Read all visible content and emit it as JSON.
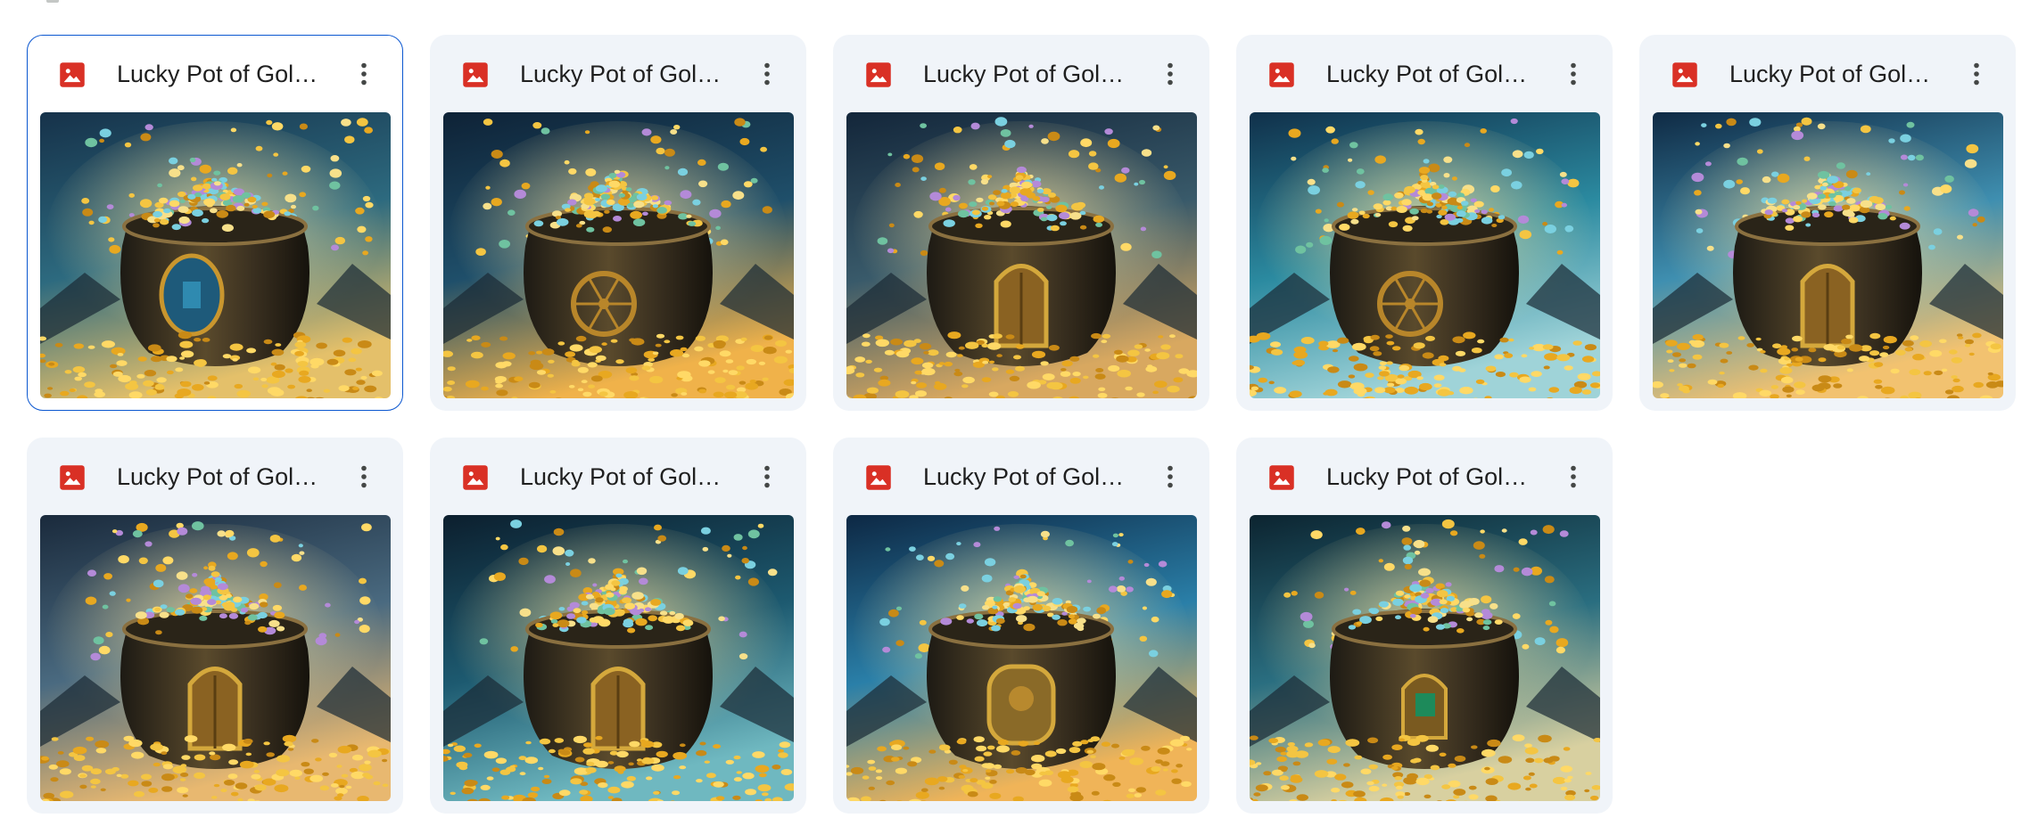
{
  "files": [
    {
      "name": "Lucky Pot of Gold ...",
      "type_icon": "image-file-icon",
      "selected": true,
      "sky": [
        "#16324a",
        "#2d6a7f",
        "#e4c06a"
      ],
      "door": "round-window"
    },
    {
      "name": "Lucky Pot of Gold ...",
      "type_icon": "image-file-icon",
      "selected": false,
      "sky": [
        "#0e2236",
        "#1f4f6a",
        "#f0b24a"
      ],
      "door": "wheel"
    },
    {
      "name": "Lucky Pot of Gold ...",
      "type_icon": "image-file-icon",
      "selected": false,
      "sky": [
        "#13263a",
        "#395a6a",
        "#d8a860"
      ],
      "door": "door"
    },
    {
      "name": "Lucky Pot of Gold ...",
      "type_icon": "image-file-icon",
      "selected": false,
      "sky": [
        "#10304a",
        "#2b8aa0",
        "#9fd3d8"
      ],
      "door": "wheel"
    },
    {
      "name": "Lucky Pot of Gold ...",
      "type_icon": "image-file-icon",
      "selected": false,
      "sky": [
        "#0f2a44",
        "#3f8fb0",
        "#f2c270"
      ],
      "door": "door"
    },
    {
      "name": "Lucky Pot of Gold ...",
      "type_icon": "image-file-icon",
      "selected": false,
      "sky": [
        "#1a2a3c",
        "#4a6a80",
        "#e8b870"
      ],
      "door": "door"
    },
    {
      "name": "Lucky Pot of Gold ...",
      "type_icon": "image-file-icon",
      "selected": false,
      "sky": [
        "#0c1f2e",
        "#1d5a70",
        "#6fb8c0"
      ],
      "door": "door"
    },
    {
      "name": "Lucky Pot of Gold ...",
      "type_icon": "image-file-icon",
      "selected": false,
      "sky": [
        "#0d2844",
        "#2a7fa8",
        "#f0b458"
      ],
      "door": "emblem"
    },
    {
      "name": "Lucky Pot of Gold ...",
      "type_icon": "image-file-icon",
      "selected": false,
      "sky": [
        "#0c2430",
        "#2a6e80",
        "#d8d0a0"
      ],
      "door": "window"
    }
  ],
  "colors": {
    "card_bg": "#f0f4f9",
    "selected_border": "#0b57d0",
    "image_icon_red": "#d93025",
    "title_text": "#1f1f1f",
    "more_icon": "#444746"
  },
  "icons": {
    "more": "more-vert-icon"
  }
}
